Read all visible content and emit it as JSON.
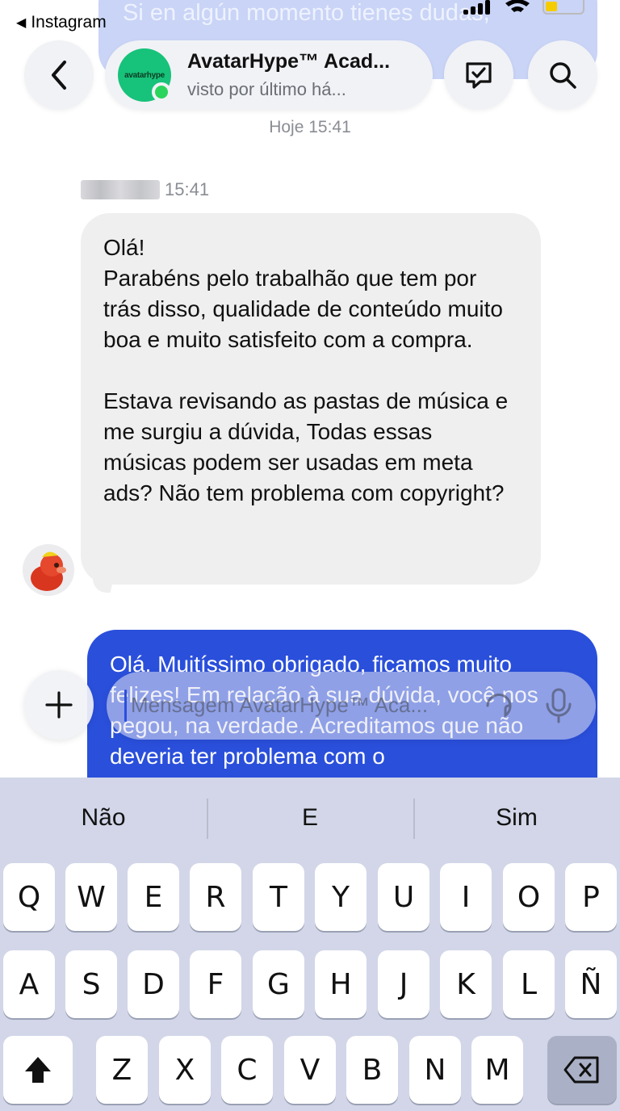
{
  "status_bar": {
    "back_app_label": "Instagram",
    "banner_text": "Si en algún momento tienes dudas,"
  },
  "header": {
    "contact_name": "AvatarHype™ Acad...",
    "contact_status": "visto por último há...",
    "avatar_logo_text": "avatarhype"
  },
  "conversation": {
    "day_separator": "Hoje 15:41",
    "sender_time": "15:41",
    "incoming_message": {
      "line1": "Olá!",
      "paragraph1": "Parabéns pelo trabalhão que tem por trás disso, qualidade de conteúdo muito boa e muito satisfeito com a compra.",
      "paragraph2": "Estava revisando as pastas de música e me surgiu a dúvida, Todas essas músicas podem ser usadas em meta ads? Não tem problema com copyright?"
    },
    "outgoing_message": {
      "text": "Olá. Muitíssimo obrigado, ficamos muito felizes! Em relação à sua dúvida, você nos pegou, na verdade. Acreditamos que não deveria ter problema com o"
    }
  },
  "composer": {
    "placeholder": "Mensagem AvatarHype™ Aca..."
  },
  "keyboard": {
    "suggestions": [
      "Não",
      "E",
      "Sim"
    ],
    "row1": [
      "Q",
      "W",
      "E",
      "R",
      "T",
      "Y",
      "U",
      "I",
      "O",
      "P"
    ],
    "row2": [
      "A",
      "S",
      "D",
      "F",
      "G",
      "H",
      "J",
      "K",
      "L",
      "Ñ"
    ],
    "row3": [
      "Z",
      "X",
      "C",
      "V",
      "B",
      "N",
      "M"
    ]
  },
  "colors": {
    "outgoing_bubble": "#2a4fdb",
    "incoming_bubble": "#efeff0",
    "keyboard_bg": "#d2d6e8",
    "online_dot": "#2bd45c"
  },
  "icons": [
    "back-chevron-icon",
    "message-check-icon",
    "search-icon",
    "plus-icon",
    "sticker-icon",
    "microphone-icon",
    "shift-icon",
    "backspace-icon"
  ]
}
